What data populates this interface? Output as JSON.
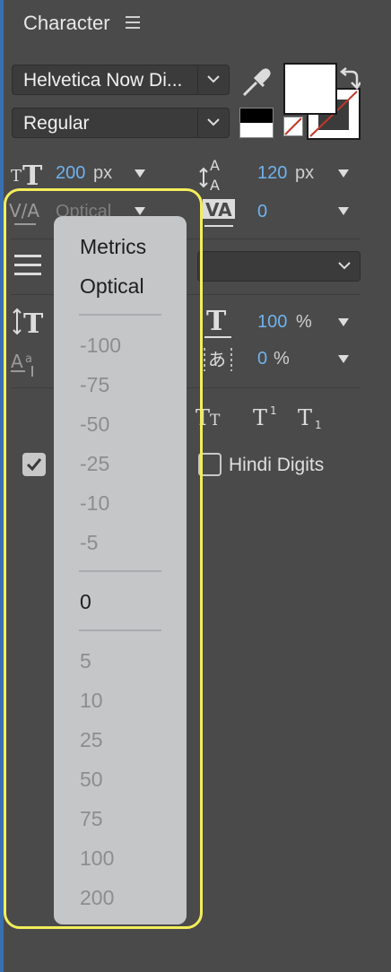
{
  "panel": {
    "title": "Character"
  },
  "font": {
    "family": "Helvetica Now Di...",
    "style": "Regular"
  },
  "size": {
    "value": "200",
    "unit": "px"
  },
  "leading": {
    "value": "120",
    "unit": "px"
  },
  "kerning": {
    "value": "Optical"
  },
  "tracking": {
    "value": "0"
  },
  "vertical_scale": {
    "value": "100",
    "unit": "%"
  },
  "tsume": {
    "value": "0",
    "unit": "%"
  },
  "hindi_digits_label": "Hindi Digits",
  "kerning_menu": {
    "items": [
      "Metrics",
      "Optical",
      "-100",
      "-75",
      "-50",
      "-25",
      "-10",
      "-5",
      "0",
      "5",
      "10",
      "25",
      "50",
      "75",
      "100",
      "200"
    ]
  },
  "colors": {
    "accent_value": "#6fb2ee",
    "highlight": "#f3ee5a",
    "stroke_none": "#c0392b"
  }
}
